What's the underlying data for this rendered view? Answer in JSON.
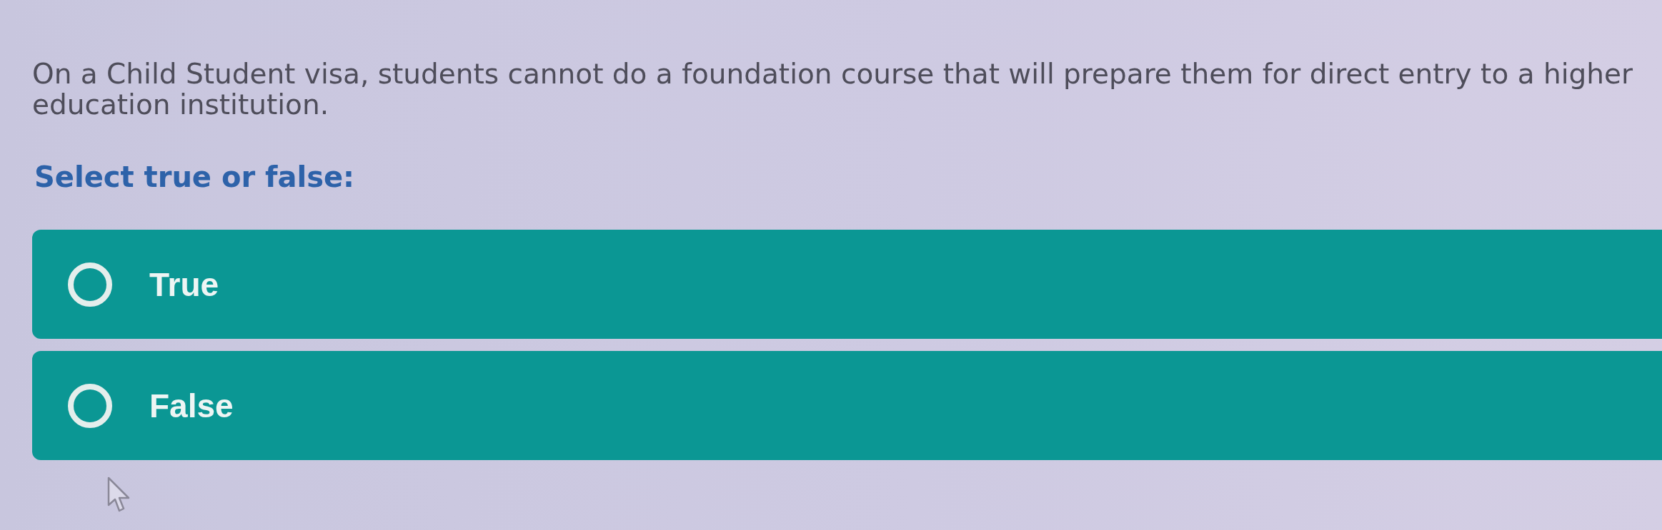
{
  "question": "On a Child Student visa, students cannot do a foundation course that will prepare them for direct entry to a higher education institution.",
  "prompt": "Select true or false:",
  "options": [
    {
      "label": "True",
      "selected": false
    },
    {
      "label": "False",
      "selected": false
    }
  ]
}
